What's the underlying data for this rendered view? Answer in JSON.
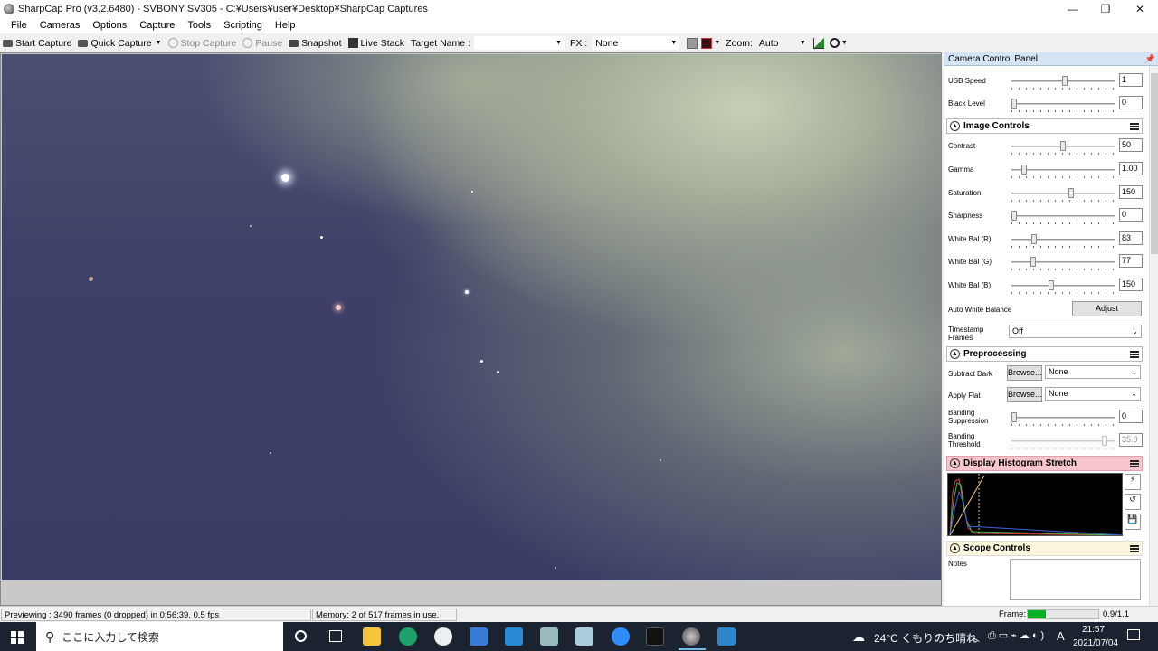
{
  "window": {
    "title": "SharpCap Pro (v3.2.6480) - SVBONY SV305 - C:¥Users¥user¥Desktop¥SharpCap Captures",
    "minimize": "—",
    "maximize": "❐",
    "close": "✕"
  },
  "menu": [
    "File",
    "Cameras",
    "Options",
    "Capture",
    "Tools",
    "Scripting",
    "Help"
  ],
  "toolbar": {
    "start_capture": "Start Capture",
    "quick_capture": "Quick Capture",
    "stop_capture": "Stop Capture",
    "pause": "Pause",
    "snapshot": "Snapshot",
    "live_stack": "Live Stack",
    "target_name_label": "Target Name :",
    "target_name_value": "",
    "fx_label": "FX :",
    "fx_value": "None",
    "zoom_label": "Zoom:",
    "zoom_value": "Auto"
  },
  "panel": {
    "title": "Camera Control Panel",
    "camera_rows": [
      {
        "label": "USB Speed",
        "value": "1",
        "level": 0.52
      },
      {
        "label": "Black Level",
        "value": "0",
        "level": 0.0
      }
    ],
    "image_controls": {
      "title": "Image Controls",
      "rows": [
        {
          "label": "Contrast",
          "value": "50",
          "level": 0.5
        },
        {
          "label": "Gamma",
          "value": "1.00",
          "level": 0.1
        },
        {
          "label": "Saturation",
          "value": "150",
          "level": 0.58
        },
        {
          "label": "Sharpness",
          "value": "0",
          "level": 0.0
        },
        {
          "label": "White Bal (R)",
          "value": "83",
          "level": 0.2
        },
        {
          "label": "White Bal (G)",
          "value": "77",
          "level": 0.19
        },
        {
          "label": "White Bal (B)",
          "value": "150",
          "level": 0.38
        }
      ],
      "auto_wb_label": "Auto White Balance",
      "adjust_button": "Adjust",
      "timestamp_label": "Timestamp Frames",
      "timestamp_value": "Off"
    },
    "preprocessing": {
      "title": "Preprocessing",
      "subtract_dark_label": "Subtract Dark",
      "apply_flat_label": "Apply Flat",
      "browse_button": "Browse...",
      "subtract_dark_value": "None",
      "apply_flat_value": "None",
      "banding_suppression_label": "Banding Suppression",
      "banding_suppression_value": "0",
      "banding_threshold_label": "Banding Threshold",
      "banding_threshold_value": "35.0"
    },
    "histogram": {
      "title": "Display Histogram Stretch"
    },
    "scope": {
      "title": "Scope Controls",
      "notes_label": "Notes"
    }
  },
  "status": {
    "preview": "Previewing : 3490 frames (0 dropped) in 0:56:39, 0.5 fps",
    "memory": "Memory: 2 of 517 frames in use.",
    "frame_label": "Frame:",
    "frame_value": "0.9/1.1",
    "frame_level": 0.25
  },
  "taskbar": {
    "search_placeholder": "ここに入力して検索",
    "weather": "24°C くもりのち晴れ",
    "ime": "A",
    "time": "21:57",
    "date": "2021/07/04"
  }
}
